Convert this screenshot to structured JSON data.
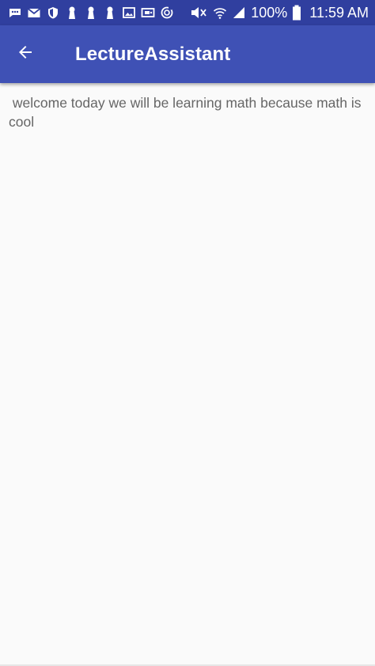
{
  "status_bar": {
    "left_icons": [
      "messages-icon",
      "gmail-icon",
      "shield-icon",
      "keyhole-icon-1",
      "keyhole-icon-2",
      "keyhole-icon-3",
      "gallery-icon",
      "cast-icon",
      "sync-icon"
    ],
    "right_icons": [
      "mute-icon",
      "wifi-icon",
      "signal-icon",
      "battery-icon"
    ],
    "battery_percent": "100%",
    "time": "11:59 AM",
    "background": "#303F9F"
  },
  "app_bar": {
    "title": "LectureAssistant",
    "back_icon": "arrow-back-icon",
    "background": "#3F51B5"
  },
  "content": {
    "text": " welcome today we will be learning math because math is cool"
  }
}
